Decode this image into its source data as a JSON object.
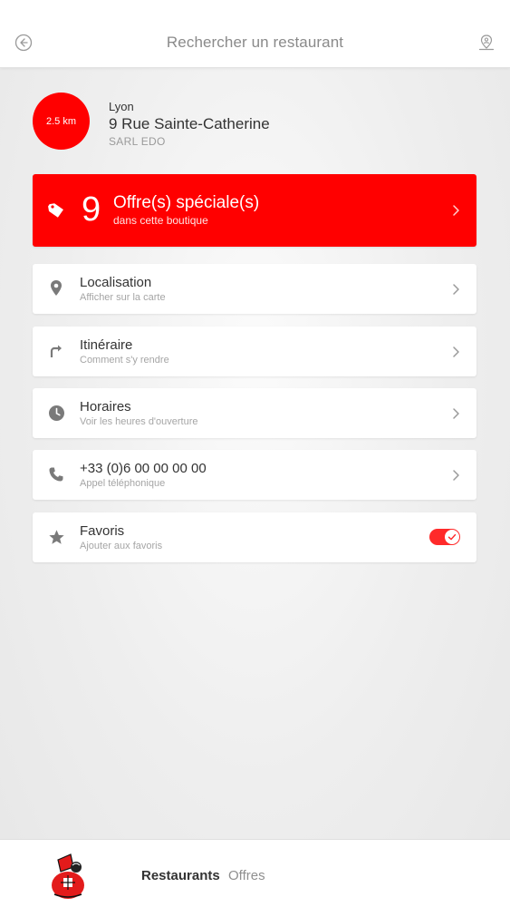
{
  "header": {
    "title": "Rechercher un restaurant",
    "back_icon": "back-arrow-circle-icon",
    "locate_icon": "person-pin-icon"
  },
  "store": {
    "distance": "2.5 km",
    "city": "Lyon",
    "street": "9 Rue Sainte-Catherine",
    "company": "SARL EDO"
  },
  "offer": {
    "count": "9",
    "title": "Offre(s) spéciale(s)",
    "subtitle": "dans cette boutique",
    "icon": "tag-icon"
  },
  "actions": [
    {
      "title": "Localisation",
      "subtitle": "Afficher sur la carte",
      "icon": "location-pin-icon"
    },
    {
      "title": "Itinéraire",
      "subtitle": "Comment s'y rendre",
      "icon": "turn-right-arrow-icon"
    },
    {
      "title": "Horaires",
      "subtitle": "Voir les heures d'ouverture",
      "icon": "clock-icon"
    },
    {
      "title": "+33 (0)6 00 00 00 00",
      "subtitle": "Appel téléphonique",
      "icon": "phone-icon"
    },
    {
      "title": "Favoris",
      "subtitle": "Ajouter aux favoris",
      "icon": "star-icon"
    }
  ],
  "favorite_toggle": {
    "on": true
  },
  "bottom_nav": {
    "tab_restaurants": "Restaurants",
    "tab_offres": "Offres",
    "active": "Restaurants"
  },
  "colors": {
    "accent": "#ff0000",
    "icon_grey": "#7a7a7a",
    "chevron_grey": "#9a9a9a"
  }
}
